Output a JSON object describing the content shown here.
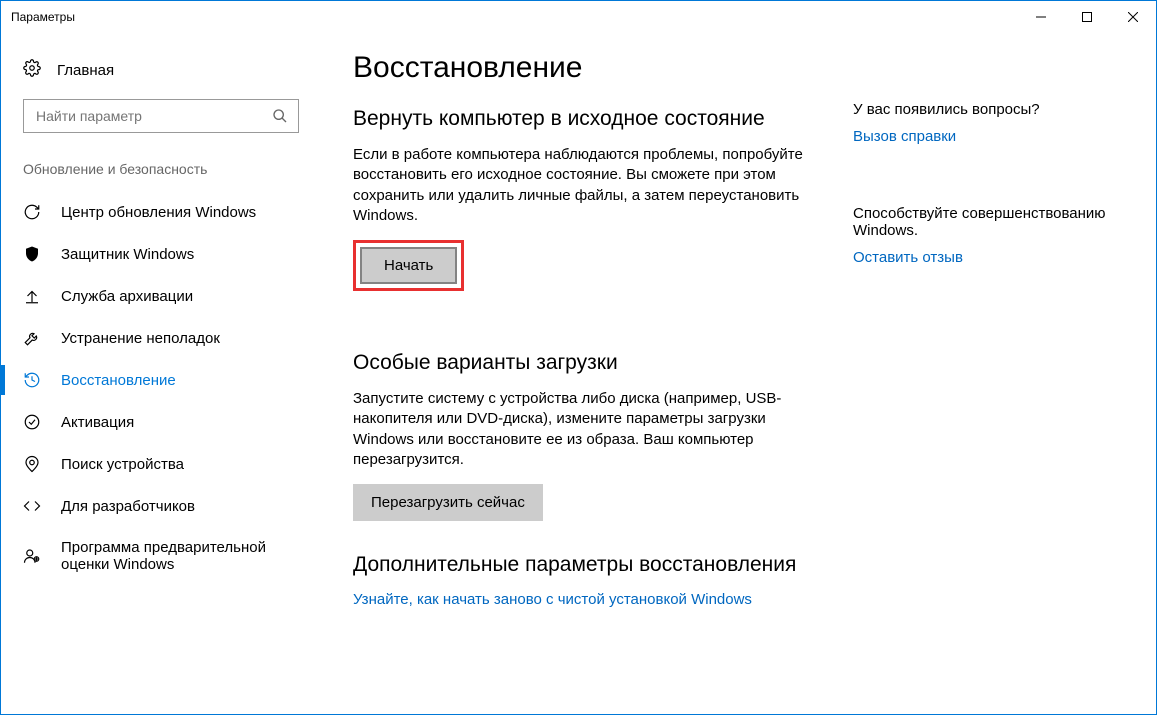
{
  "window": {
    "title": "Параметры"
  },
  "sidebar": {
    "home": "Главная",
    "search_placeholder": "Найти параметр",
    "group": "Обновление и безопасность",
    "items": [
      {
        "label": "Центр обновления Windows"
      },
      {
        "label": "Защитник Windows"
      },
      {
        "label": "Служба архивации"
      },
      {
        "label": "Устранение неполадок"
      },
      {
        "label": "Восстановление"
      },
      {
        "label": "Активация"
      },
      {
        "label": "Поиск устройства"
      },
      {
        "label": "Для разработчиков"
      },
      {
        "label": "Программа предварительной оценки Windows"
      }
    ]
  },
  "main": {
    "title": "Восстановление",
    "reset": {
      "heading": "Вернуть компьютер в исходное состояние",
      "text": "Если в работе компьютера наблюдаются проблемы, попробуйте восстановить его исходное состояние. Вы сможете при этом сохранить или удалить личные файлы, а затем переустановить Windows.",
      "button": "Начать"
    },
    "advanced": {
      "heading": "Особые варианты загрузки",
      "text": "Запустите систему с устройства либо диска (например, USB-накопителя или DVD-диска), измените параметры загрузки Windows или восстановите ее из образа. Ваш компьютер перезагрузится.",
      "button": "Перезагрузить сейчас"
    },
    "more": {
      "heading": "Дополнительные параметры восстановления",
      "link": "Узнайте, как начать заново с чистой установкой Windows"
    }
  },
  "rightside": {
    "questions": {
      "heading": "У вас появились вопросы?",
      "link": "Вызов справки"
    },
    "feedback": {
      "heading": "Способствуйте совершенствованию Windows.",
      "link": "Оставить отзыв"
    }
  }
}
